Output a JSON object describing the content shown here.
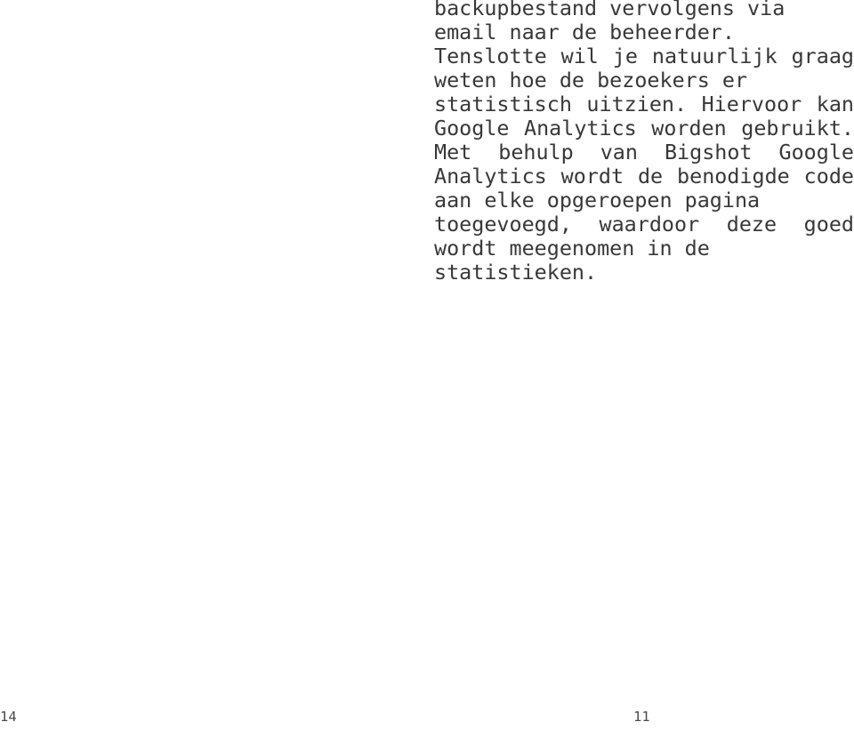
{
  "page": {
    "background_color": "#ffffff",
    "text_color": "#38383a",
    "language": "nl"
  },
  "content": {
    "paragraph_1": "backupbestand vervolgens via email naar de beheerder.",
    "paragraph_2": "Tenslotte wil je natuurlijk graag weten hoe de bezoekers er statistisch uitzien. Hiervoor kan Google Analytics worden gebruikt.",
    "paragraph_3": "Met behulp van Bigshot Google Analytics wordt de benodigde code aan elke opgeroepen pagina toegevoegd, waardoor deze goed wordt meegenomen in de statistieken.",
    "lines": [
      "backupbestand vervolgens via",
      "email naar de beheerder.",
      "Tenslotte wil je natuurlijk graag",
      "weten hoe de bezoekers er",
      "statistisch uitzien. Hiervoor kan",
      "Google Analytics worden gebruikt.",
      "Met behulp van Bigshot Google",
      "Analytics wordt de benodigde code",
      "aan elke opgeroepen pagina",
      "toegevoegd, waardoor deze goed",
      "wordt meegenomen in de",
      "statistieken."
    ]
  },
  "footer": {
    "left_folio": "14",
    "right_folio": "11"
  }
}
